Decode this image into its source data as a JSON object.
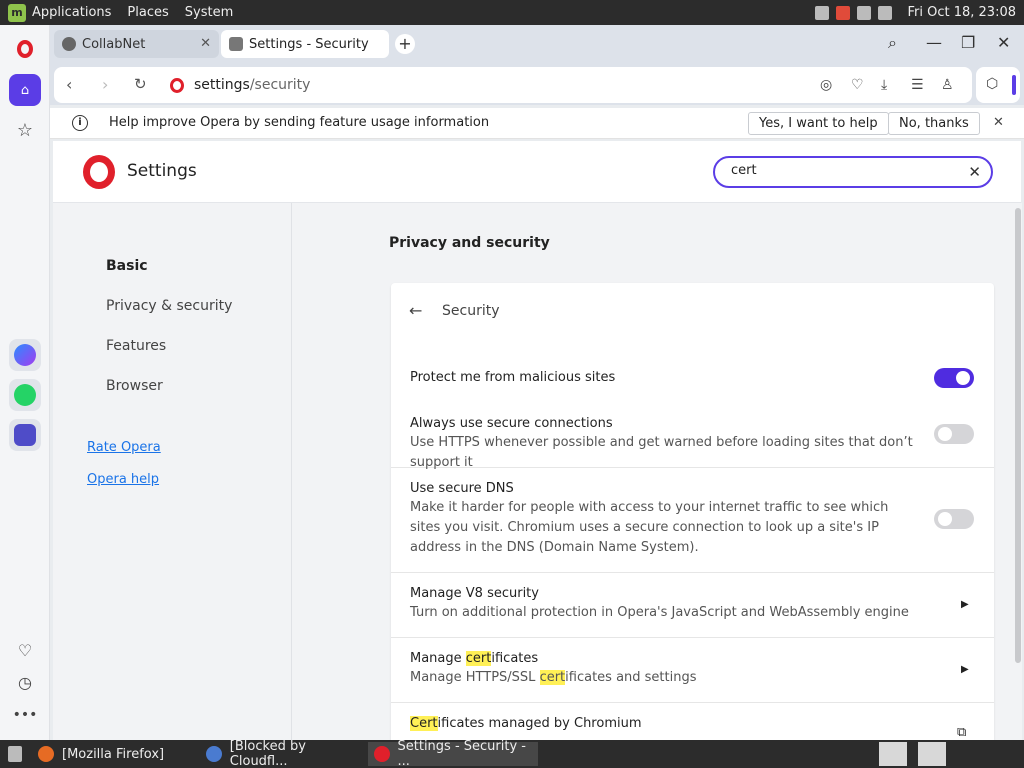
{
  "system_panel": {
    "menus": [
      "Applications",
      "Places",
      "System"
    ],
    "clock": "Fri Oct 18, 23:08"
  },
  "tabs": [
    {
      "title": "CollabNet"
    },
    {
      "title": "Settings - Security"
    }
  ],
  "address": {
    "url_host": "settings",
    "url_path": "/security"
  },
  "infobar": {
    "message": "Help improve Opera by sending feature usage information",
    "accept_label": "Yes, I want to help",
    "decline_label": "No, thanks"
  },
  "settings": {
    "title": "Settings",
    "search_value": "cert",
    "nav": [
      "Basic",
      "Privacy & security",
      "Features",
      "Browser"
    ],
    "links": [
      "Rate Opera",
      "Opera help"
    ],
    "section_title": "Privacy and security",
    "card_title": "Security",
    "rows": [
      {
        "title": "Protect me from malicious sites",
        "toggle": true
      },
      {
        "title": "Always use secure connections",
        "desc": "Use HTTPS whenever possible and get warned before loading sites that don’t support it",
        "toggle": false
      },
      {
        "title": "Use secure DNS",
        "desc": "Make it harder for people with access to your internet traffic to see which sites you visit. Chromium uses a secure connection to look up a site's IP address in the DNS (Domain Name System).",
        "toggle": false
      },
      {
        "title": "Manage V8 security",
        "desc": "Turn on additional protection in Opera's JavaScript and WebAssembly engine"
      },
      {
        "title_pre": "Manage ",
        "title_hl": "cert",
        "title_post": "ificates",
        "desc_pre": "Manage HTTPS/SSL ",
        "desc_hl": "cert",
        "desc_post": "ificates and settings"
      },
      {
        "title_hl": "Cert",
        "title_post": "ificates managed by Chromium"
      }
    ]
  },
  "taskbar": [
    {
      "title": "[Mozilla Firefox]"
    },
    {
      "title": "[Blocked by Cloudfl..."
    },
    {
      "title": "Settings - Security - ..."
    }
  ],
  "colors": {
    "accent": "#5b3de6",
    "opera_red": "#e0202b",
    "highlight": "#fff056"
  }
}
